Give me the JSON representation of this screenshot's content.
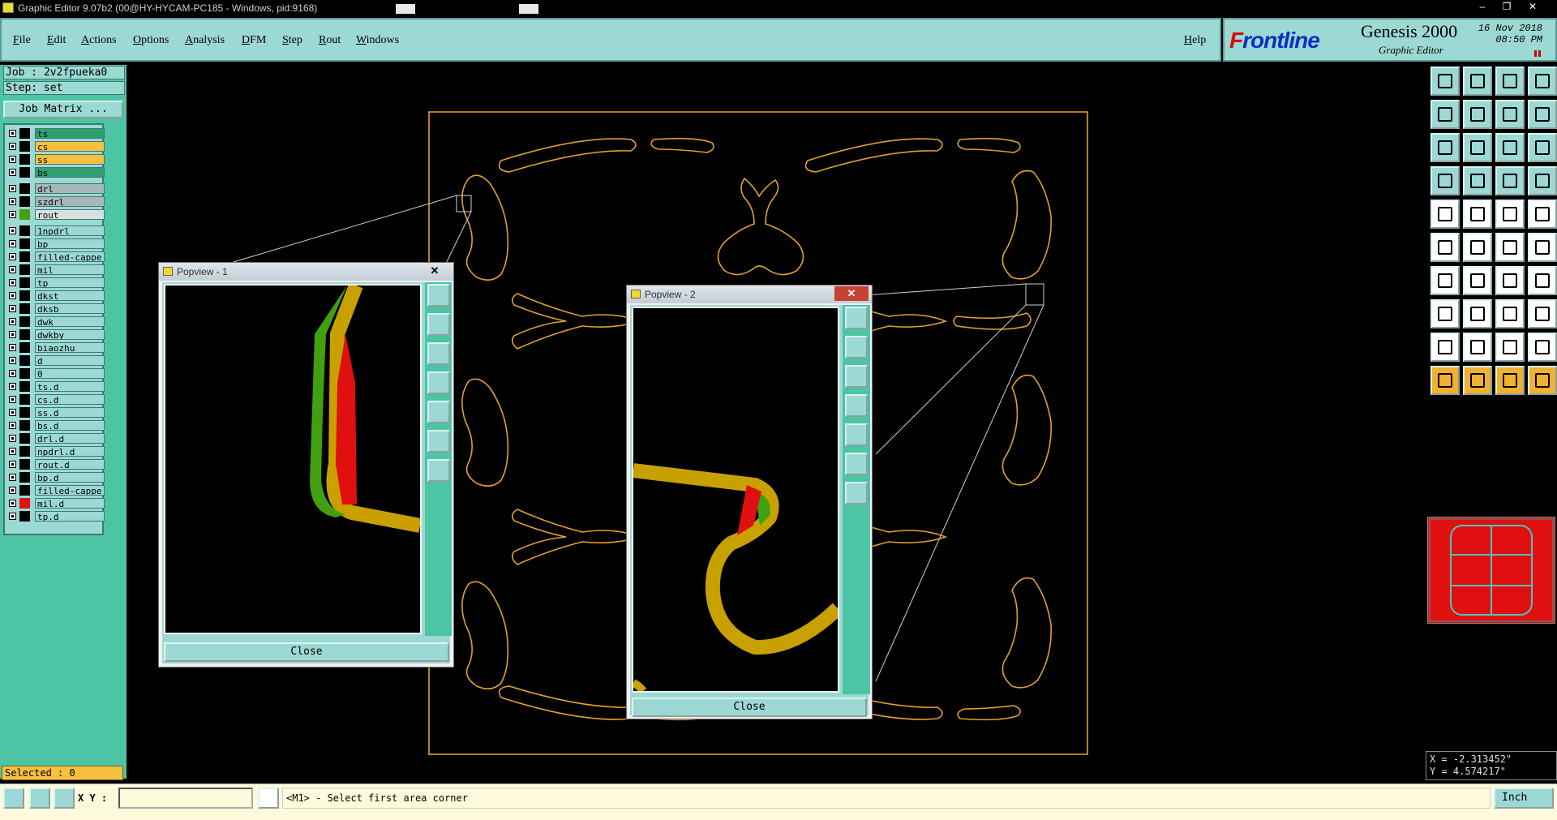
{
  "window": {
    "title": "Graphic Editor 9.07b2 (00@HY-HYCAM-PC185 - Windows, pid:9168)"
  },
  "menu": [
    {
      "label": "File",
      "ul": "F",
      "rest": "ile"
    },
    {
      "label": "Edit",
      "ul": "E",
      "rest": "dit"
    },
    {
      "label": "Actions",
      "ul": "A",
      "rest": "ctions"
    },
    {
      "label": "Options",
      "ul": "O",
      "rest": "ptions"
    },
    {
      "label": "Analysis",
      "ul": "A",
      "rest": "nalysis"
    },
    {
      "label": "DFM",
      "ul": "D",
      "rest": "FM"
    },
    {
      "label": "Step",
      "ul": "S",
      "rest": "tep"
    },
    {
      "label": "Rout",
      "ul": "R",
      "rest": "out"
    },
    {
      "label": "Windows",
      "ul": "W",
      "rest": "indows"
    }
  ],
  "help": {
    "ul": "H",
    "rest": "elp"
  },
  "brand": {
    "logo_first": "F",
    "logo_rest": "rontline",
    "product": "Genesis 2000",
    "subtitle": "Graphic Editor",
    "date": "16 Nov 2018",
    "time": "08:50 PM"
  },
  "job": {
    "job": "Job : 2v2fpueka0",
    "step": "Step: set",
    "matrix_button": "Job Matrix ..."
  },
  "layers": [
    {
      "name": "ts",
      "bg": "#30a070",
      "sw": "#000000"
    },
    {
      "name": "cs",
      "bg": "#f8c040",
      "sw": "#000000"
    },
    {
      "name": "ss",
      "bg": "#f8c040",
      "sw": "#000000"
    },
    {
      "name": "bs",
      "bg": "#30a070",
      "sw": "#000000"
    },
    {
      "name": "drl",
      "bg": "#a8b8b8",
      "sw": "#000000"
    },
    {
      "name": "szdrl",
      "bg": "#a8b8b8",
      "sw": "#000000"
    },
    {
      "name": "rout",
      "bg": "#d8e0e0",
      "sw": "#40a010"
    },
    {
      "name": "1npdrl",
      "bg": "#9cd8d4",
      "sw": "#000000"
    },
    {
      "name": "bp",
      "bg": "#9cd8d4",
      "sw": "#000000"
    },
    {
      "name": "filled-cappe",
      "bg": "#9cd8d4",
      "sw": "#000000"
    },
    {
      "name": "mil",
      "bg": "#9cd8d4",
      "sw": "#000000"
    },
    {
      "name": "tp",
      "bg": "#9cd8d4",
      "sw": "#000000"
    },
    {
      "name": "dkst",
      "bg": "#9cd8d4",
      "sw": "#000000"
    },
    {
      "name": "dksb",
      "bg": "#9cd8d4",
      "sw": "#000000"
    },
    {
      "name": "dwk",
      "bg": "#9cd8d4",
      "sw": "#000000"
    },
    {
      "name": "dwkby",
      "bg": "#9cd8d4",
      "sw": "#000000"
    },
    {
      "name": "biaozhu",
      "bg": "#9cd8d4",
      "sw": "#000000"
    },
    {
      "name": "d",
      "bg": "#9cd8d4",
      "sw": "#000000"
    },
    {
      "name": "0",
      "bg": "#9cd8d4",
      "sw": "#000000"
    },
    {
      "name": "ts.d",
      "bg": "#9cd8d4",
      "sw": "#000000"
    },
    {
      "name": "cs.d",
      "bg": "#9cd8d4",
      "sw": "#000000"
    },
    {
      "name": "ss.d",
      "bg": "#9cd8d4",
      "sw": "#000000"
    },
    {
      "name": "bs.d",
      "bg": "#9cd8d4",
      "sw": "#000000"
    },
    {
      "name": "drl.d",
      "bg": "#9cd8d4",
      "sw": "#000000"
    },
    {
      "name": "npdrl.d",
      "bg": "#9cd8d4",
      "sw": "#000000"
    },
    {
      "name": "rout.d",
      "bg": "#9cd8d4",
      "sw": "#000000"
    },
    {
      "name": "bp.d",
      "bg": "#9cd8d4",
      "sw": "#000000"
    },
    {
      "name": "filled-cappe",
      "bg": "#9cd8d4",
      "sw": "#000000"
    },
    {
      "name": "mil.d",
      "bg": "#9cd8d4",
      "sw": "#e01010"
    },
    {
      "name": "tp.d",
      "bg": "#9cd8d4",
      "sw": "#000000"
    }
  ],
  "status": {
    "selected": "Selected : 0",
    "xy_label": "X Y :",
    "xy_value": "",
    "message": "<M1> - Select first area corner",
    "unit": "Inch"
  },
  "coords": {
    "x": "X = -2.313452\"",
    "y": "Y =  4.574217\""
  },
  "popview1": {
    "title": "Popview - 1",
    "close": "Close"
  },
  "popview2": {
    "title": "Popview - 2",
    "close": "Close"
  },
  "colors": {
    "panel": "#9cd8d4",
    "panel_dark": "#4dc4a4",
    "rout": "#c8a000",
    "outline": "#e0a030",
    "highlight": "#e01010",
    "green": "#40a010"
  }
}
